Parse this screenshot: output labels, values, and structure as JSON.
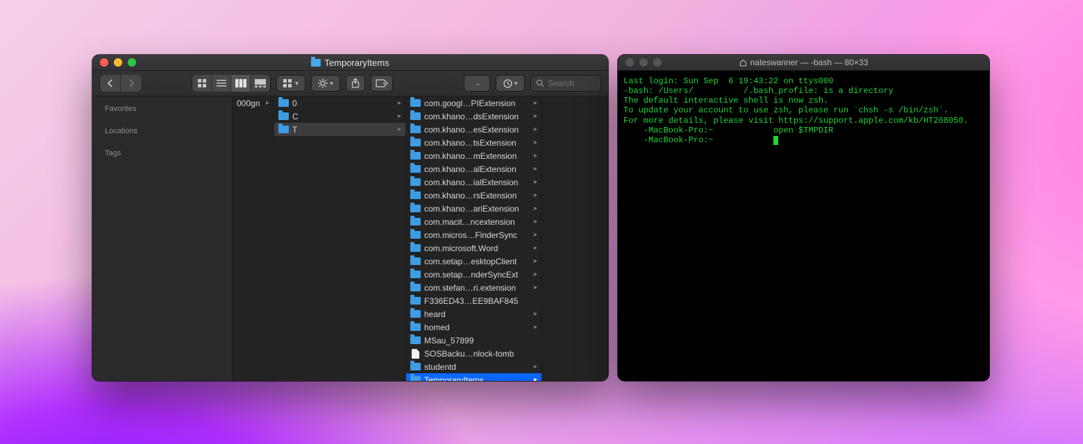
{
  "finder": {
    "title": "TemporaryItems",
    "search_placeholder": "Search",
    "sidebar": {
      "headers": [
        "Favorites",
        "Locations",
        "Tags"
      ]
    },
    "col0": [
      {
        "label": "000gn",
        "chevron": true
      }
    ],
    "col1": [
      {
        "label": "0",
        "chevron": true,
        "selected": false
      },
      {
        "label": "C",
        "chevron": true,
        "selected": false
      },
      {
        "label": "T",
        "chevron": true,
        "selected": true
      }
    ],
    "col2": [
      {
        "label": "com.googl…PIExtension",
        "chevron": true,
        "type": "folder"
      },
      {
        "label": "com.khano…dsExtension",
        "chevron": true,
        "type": "folder"
      },
      {
        "label": "com.khano…esExtension",
        "chevron": true,
        "type": "folder"
      },
      {
        "label": "com.khano…tsExtension",
        "chevron": true,
        "type": "folder"
      },
      {
        "label": "com.khano…mExtension",
        "chevron": true,
        "type": "folder"
      },
      {
        "label": "com.khano…alExtension",
        "chevron": true,
        "type": "folder"
      },
      {
        "label": "com.khano…ialExtension",
        "chevron": true,
        "type": "folder"
      },
      {
        "label": "com.khano…rsExtension",
        "chevron": true,
        "type": "folder"
      },
      {
        "label": "com.khano…ariExtension",
        "chevron": true,
        "type": "folder"
      },
      {
        "label": "com.macit…ncextension",
        "chevron": true,
        "type": "folder"
      },
      {
        "label": "com.micros…FinderSync",
        "chevron": true,
        "type": "folder"
      },
      {
        "label": "com.microsoft.Word",
        "chevron": true,
        "type": "folder"
      },
      {
        "label": "com.setap…esktopClient",
        "chevron": true,
        "type": "folder"
      },
      {
        "label": "com.setap…nderSyncExt",
        "chevron": true,
        "type": "folder"
      },
      {
        "label": "com.stefan…ri.extension",
        "chevron": true,
        "type": "folder"
      },
      {
        "label": "F336ED43…EE9BAF845",
        "chevron": false,
        "type": "folder"
      },
      {
        "label": "heard",
        "chevron": true,
        "type": "folder"
      },
      {
        "label": "homed",
        "chevron": true,
        "type": "folder"
      },
      {
        "label": "MSau_57899",
        "chevron": false,
        "type": "folder"
      },
      {
        "label": "SOSBacku…nlock-tomb",
        "chevron": false,
        "type": "file"
      },
      {
        "label": "studentd",
        "chevron": true,
        "type": "folder"
      },
      {
        "label": "TemporaryItems",
        "chevron": true,
        "type": "folder",
        "selected": true
      }
    ]
  },
  "terminal": {
    "title": "nateswanner — -bash — 80×33",
    "lines": [
      "Last login: Sun Sep  6 19:43:22 on ttys000",
      "-bash: /Users/          /.bash_profile: is a directory",
      "",
      "The default interactive shell is now zsh.",
      "To update your account to use zsh, please run `chsh -s /bin/zsh`.",
      "For more details, please visit https://support.apple.com/kb/HT208050.",
      "    -MacBook-Pro:~            open $TMPDIR",
      "    -MacBook-Pro:~            "
    ]
  }
}
